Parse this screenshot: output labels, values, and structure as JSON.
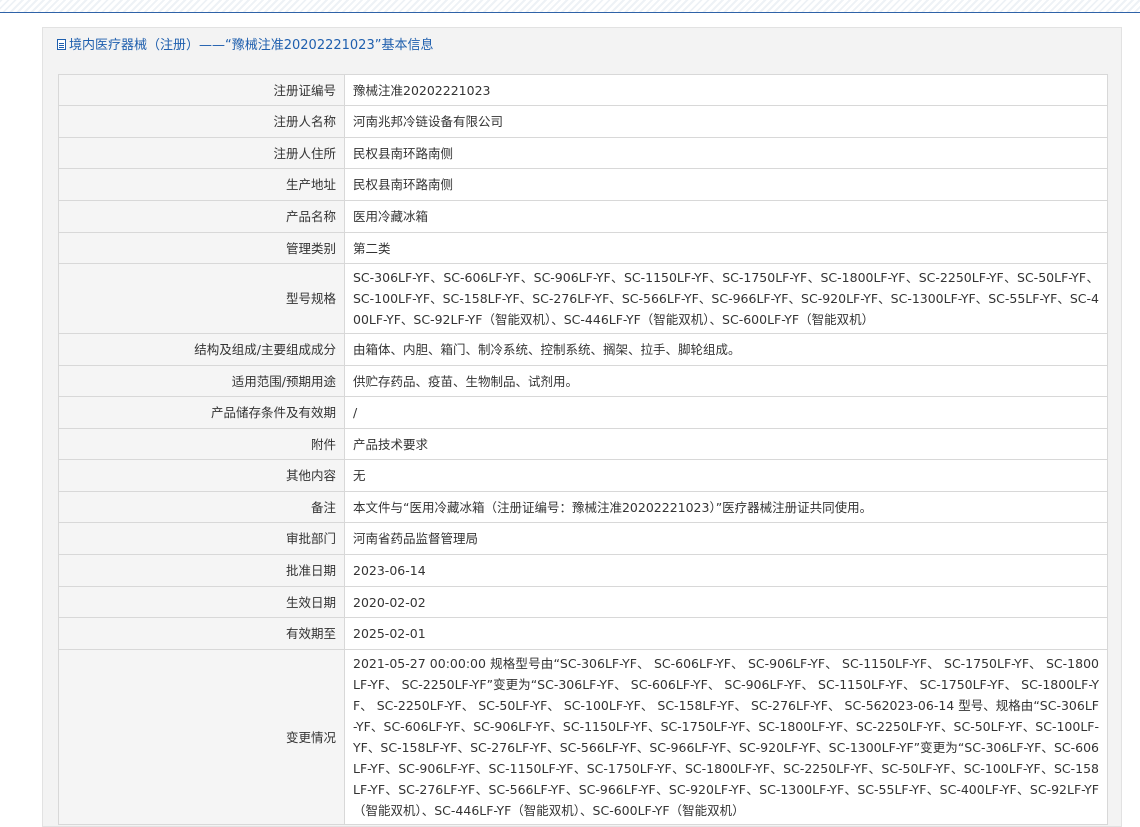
{
  "header": {
    "title": "境内医疗器械（注册）——“豫械注准20202221023”基本信息"
  },
  "rows": [
    {
      "label": "注册证编号",
      "value": "豫械注准20202221023"
    },
    {
      "label": "注册人名称",
      "value": "河南兆邦冷链设备有限公司"
    },
    {
      "label": "注册人住所",
      "value": "民权县南环路南侧"
    },
    {
      "label": "生产地址",
      "value": "民权县南环路南侧"
    },
    {
      "label": "产品名称",
      "value": "医用冷藏冰箱"
    },
    {
      "label": "管理类别",
      "value": "第二类"
    },
    {
      "label": "型号规格",
      "value": "SC-306LF-YF、SC-606LF-YF、SC-906LF-YF、SC-1150LF-YF、SC-1750LF-YF、SC-1800LF-YF、SC-2250LF-YF、SC-50LF-YF、SC-100LF-YF、SC-158LF-YF、SC-276LF-YF、SC-566LF-YF、SC-966LF-YF、SC-920LF-YF、SC-1300LF-YF、SC-55LF-YF、SC-400LF-YF、SC-92LF-YF（智能双机）、SC-446LF-YF（智能双机）、SC-600LF-YF（智能双机）"
    },
    {
      "label": "结构及组成/主要组成成分",
      "value": "由箱体、内胆、箱门、制冷系统、控制系统、搁架、拉手、脚轮组成。"
    },
    {
      "label": "适用范围/预期用途",
      "value": "供贮存药品、疫苗、生物制品、试剂用。"
    },
    {
      "label": "产品储存条件及有效期",
      "value": "/"
    },
    {
      "label": "附件",
      "value": "产品技术要求"
    },
    {
      "label": "其他内容",
      "value": "无"
    },
    {
      "label": "备注",
      "value": "本文件与“医用冷藏冰箱（注册证编号：豫械注准20202221023）”医疗器械注册证共同使用。"
    },
    {
      "label": "审批部门",
      "value": "河南省药品监督管理局"
    },
    {
      "label": "批准日期",
      "value": "2023-06-14"
    },
    {
      "label": "生效日期",
      "value": "2020-02-02"
    },
    {
      "label": "有效期至",
      "value": "2025-02-01"
    },
    {
      "label": "变更情况",
      "value": "2021-05-27 00:00:00 规格型号由“SC-306LF-YF、 SC-606LF-YF、 SC-906LF-YF、 SC-1150LF-YF、 SC-1750LF-YF、 SC-1800LF-YF、 SC-2250LF-YF”变更为“SC-306LF-YF、 SC-606LF-YF、 SC-906LF-YF、 SC-1150LF-YF、 SC-1750LF-YF、 SC-1800LF-YF、 SC-2250LF-YF、 SC-50LF-YF、 SC-100LF-YF、 SC-158LF-YF、 SC-276LF-YF、 SC-562023-06-14 型号、规格由“SC-306LF-YF、SC-606LF-YF、SC-906LF-YF、SC-1150LF-YF、SC-1750LF-YF、SC-1800LF-YF、SC-2250LF-YF、SC-50LF-YF、SC-100LF-YF、SC-158LF-YF、SC-276LF-YF、SC-566LF-YF、SC-966LF-YF、SC-920LF-YF、SC-1300LF-YF”变更为“SC-306LF-YF、SC-606LF-YF、SC-906LF-YF、SC-1150LF-YF、SC-1750LF-YF、SC-1800LF-YF、SC-2250LF-YF、SC-50LF-YF、SC-100LF-YF、SC-158LF-YF、SC-276LF-YF、SC-566LF-YF、SC-966LF-YF、SC-920LF-YF、SC-1300LF-YF、SC-55LF-YF、SC-400LF-YF、SC-92LF-YF（智能双机）、SC-446LF-YF（智能双机）、SC-600LF-YF（智能双机）"
    }
  ]
}
